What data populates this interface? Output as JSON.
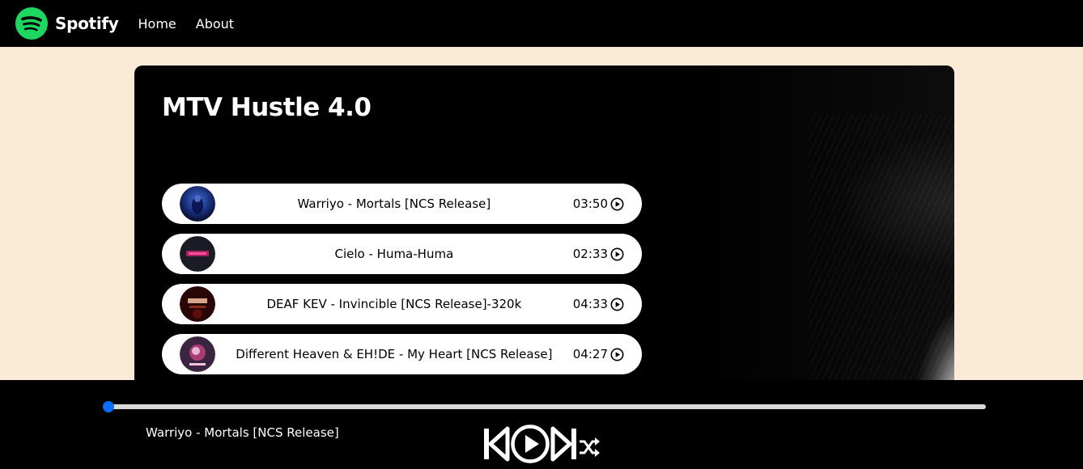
{
  "nav": {
    "brand": "Spotify",
    "links": [
      "Home",
      "About"
    ]
  },
  "playlist": {
    "title": "MTV Hustle 4.0",
    "songs": [
      {
        "name": "Warriyo - Mortals [NCS Release]",
        "duration": "03:50"
      },
      {
        "name": "Cielo - Huma-Huma",
        "duration": "02:33"
      },
      {
        "name": "DEAF KEV - Invincible [NCS Release]-320k",
        "duration": "04:33"
      },
      {
        "name": "Different Heaven & EH!DE - My Heart [NCS Release]",
        "duration": "04:27"
      }
    ]
  },
  "player": {
    "now_playing": "Warriyo - Mortals [NCS Release]",
    "progress": 0
  },
  "colors": {
    "background": "#faebd7",
    "accent": "#0d6efd",
    "brand_green": "#1ed760"
  },
  "icons": [
    "spotify-logo-icon",
    "play-circle-icon",
    "skip-back-icon",
    "play-main-icon",
    "skip-forward-icon",
    "shuffle-icon"
  ]
}
